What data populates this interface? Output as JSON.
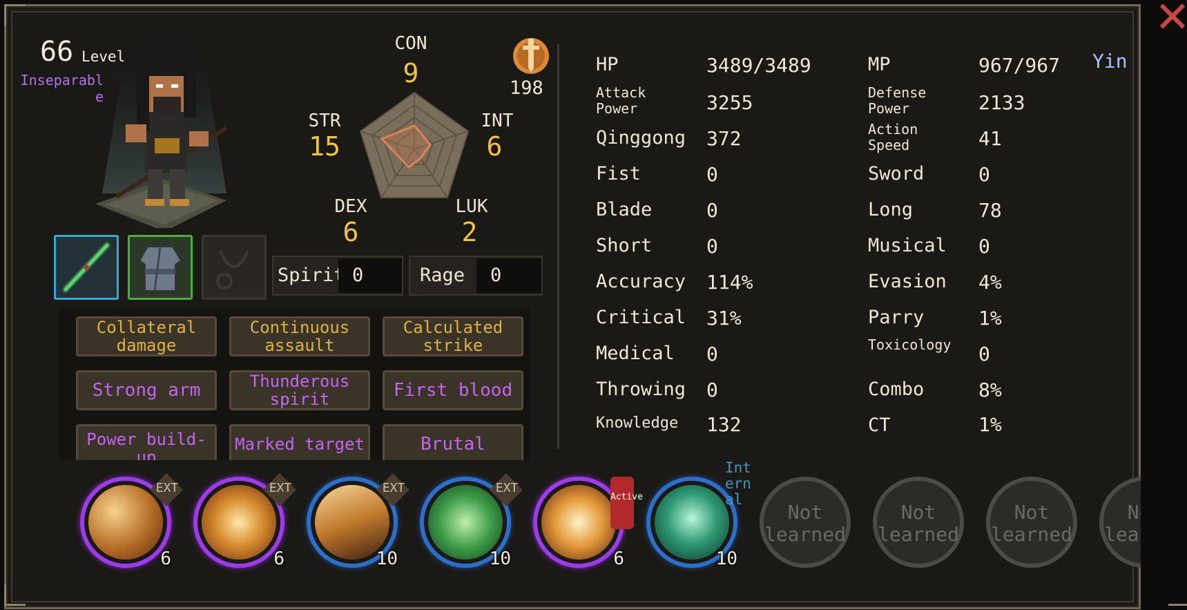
{
  "character": {
    "level_number": "66",
    "level_label": "Level",
    "title": "Inseparable"
  },
  "stats": {
    "con": {
      "label": "CON",
      "value": "9"
    },
    "str": {
      "label": "STR",
      "value": "15"
    },
    "int": {
      "label": "INT",
      "value": "6"
    },
    "dex": {
      "label": "DEX",
      "value": "6"
    },
    "luk": {
      "label": "LUK",
      "value": "2"
    },
    "medal_value": "198"
  },
  "bars": {
    "spirit": {
      "label": "Spirit",
      "value": "0"
    },
    "rage": {
      "label": "Rage",
      "value": "0"
    }
  },
  "traits": [
    {
      "label": "Collateral damage",
      "color": "#e0b23e"
    },
    {
      "label": "Continuous assault",
      "color": "#e0b23e"
    },
    {
      "label": "Calculated strike",
      "color": "#e0b23e"
    },
    {
      "label": "Strong arm",
      "color": "#c465f1"
    },
    {
      "label": "Thunderous spirit",
      "color": "#c465f1"
    },
    {
      "label": "First blood",
      "color": "#c465f1"
    },
    {
      "label": "Power build-up",
      "color": "#c465f1"
    },
    {
      "label": "Marked target",
      "color": "#c465f1"
    },
    {
      "label": "Brutal",
      "color": "#c465f1"
    }
  ],
  "attributes_left": [
    {
      "label": "HP",
      "value": "3489/3489"
    },
    {
      "label": "Attack Power",
      "value": "3255"
    },
    {
      "label": "Qinggong",
      "value": "372"
    },
    {
      "label": "Fist",
      "value": "0"
    },
    {
      "label": "Blade",
      "value": "0"
    },
    {
      "label": "Short",
      "value": "0"
    },
    {
      "label": "Accuracy",
      "value": "114%"
    },
    {
      "label": "Critical",
      "value": "31%"
    },
    {
      "label": "Medical",
      "value": "0"
    },
    {
      "label": "Throwing",
      "value": "0"
    },
    {
      "label": "Knowledge",
      "value": "132"
    }
  ],
  "attributes_right": [
    {
      "label": "MP",
      "value": "967/967"
    },
    {
      "label": "Defense Power",
      "value": "2133"
    },
    {
      "label": "Action Speed",
      "value": "41"
    },
    {
      "label": "Sword",
      "value": "0"
    },
    {
      "label": "Long",
      "value": "78"
    },
    {
      "label": "Musical",
      "value": "0"
    },
    {
      "label": "Evasion",
      "value": "4%"
    },
    {
      "label": "Parry",
      "value": "1%"
    },
    {
      "label": "Toxicology",
      "value": "0"
    },
    {
      "label": "Combo",
      "value": "8%"
    },
    {
      "label": "CT",
      "value": "1%"
    }
  ],
  "alignment": "Yin",
  "skills": [
    {
      "level": "6",
      "tag": "EXT",
      "ring": "purple"
    },
    {
      "level": "6",
      "tag": "EXT",
      "ring": "purple"
    },
    {
      "level": "10",
      "tag": "EXT",
      "ring": "blue"
    },
    {
      "level": "10",
      "tag": "EXT",
      "ring": "blue"
    },
    {
      "level": "6",
      "tag": "Active",
      "ring": "purple"
    },
    {
      "level": "10",
      "tag": "Internal",
      "ring": "blue"
    },
    {
      "not_learned": "Not learned"
    },
    {
      "not_learned": "Not learned"
    },
    {
      "not_learned": "Not learned"
    },
    {
      "not_learned": "Not learned"
    }
  ],
  "colors": {
    "gold_text": "#f3c23f",
    "purple_text": "#c465f1",
    "weapon_slot_border": "#35a9d6",
    "armor_slot_border": "#4caf3c",
    "close": "#c74848"
  }
}
